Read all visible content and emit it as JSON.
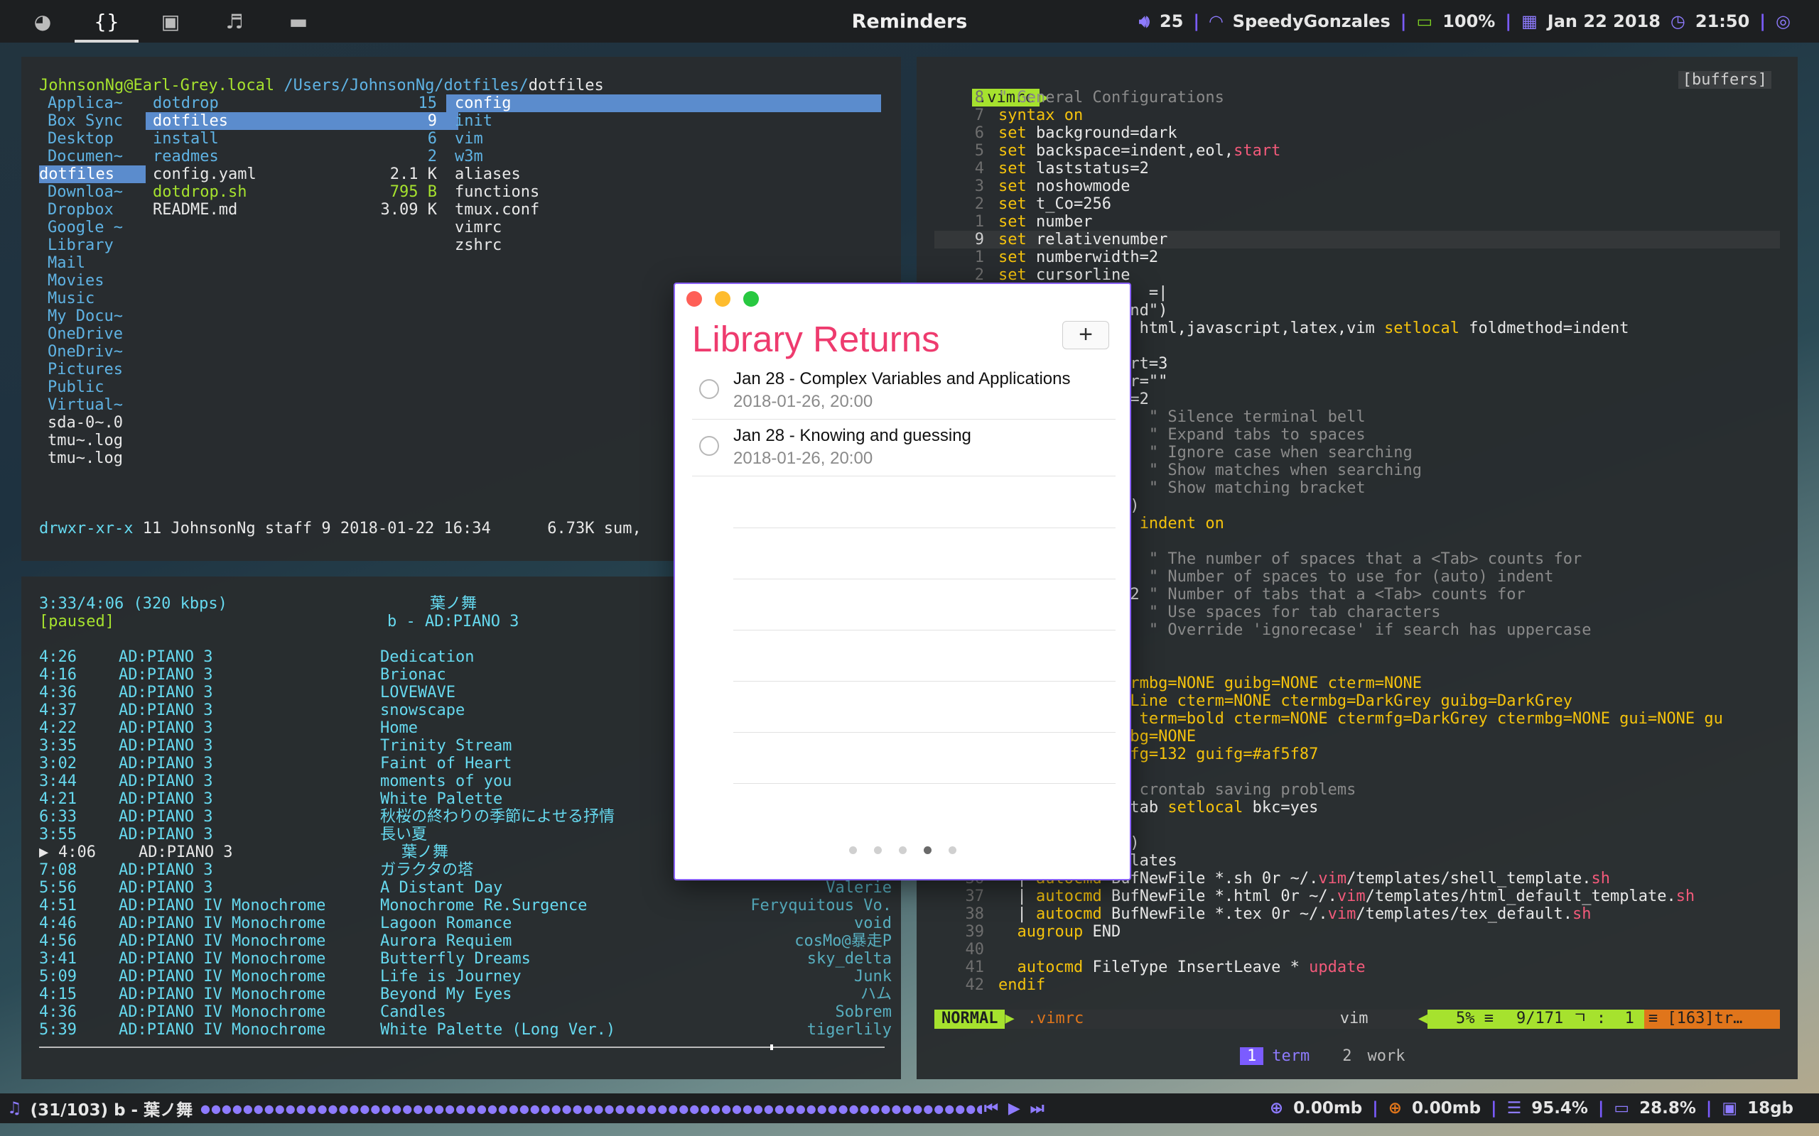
{
  "topbar": {
    "workspaces": [
      {
        "icon": "ghost-icon",
        "glyph": "◕",
        "active": false
      },
      {
        "icon": "code-braces-icon",
        "glyph": "{}",
        "active": true
      },
      {
        "icon": "terminal-icon",
        "glyph": "▣",
        "active": false
      },
      {
        "icon": "music-icon",
        "glyph": "♬",
        "active": false
      },
      {
        "icon": "folder-icon",
        "glyph": "▬",
        "active": false
      }
    ],
    "title": "Reminders",
    "volume": "25",
    "wifi": "SpeedyGonzales",
    "battery": "100%",
    "date": "Jan 22 2018",
    "time": "21:50"
  },
  "ranger": {
    "header_user": "JohnsonNg@Earl-Grey.local",
    "header_path": "/Users/JohnsonNg/dotfiles/",
    "header_dir": "dotfiles",
    "col1": [
      "Applica~",
      "Box Sync",
      "Desktop",
      "Documen~",
      "dotfiles",
      "Downloa~",
      "Dropbox",
      "Google ~",
      "Library",
      "Mail",
      "Movies",
      "Music",
      "My Docu~",
      "OneDrive",
      "OneDriv~",
      "Pictures",
      "Public",
      "Virtual~",
      "sda-0~.0",
      "tmu~.log",
      "tmu~.log"
    ],
    "col2": [
      {
        "name": "dotdrop",
        "size": "15"
      },
      {
        "name": "dotfiles",
        "size": "9"
      },
      {
        "name": "install",
        "size": "6"
      },
      {
        "name": "readmes",
        "size": "2"
      },
      {
        "name": "config.yaml",
        "size": "2.1 K"
      },
      {
        "name": "dotdrop.sh",
        "size": "795 B"
      },
      {
        "name": "README.md",
        "size": "3.09 K"
      }
    ],
    "col3": [
      "config",
      "init",
      "vim",
      "w3m",
      "aliases",
      "functions",
      "tmux.conf",
      "vimrc",
      "zshrc"
    ],
    "status_perm": "drwxr-xr-x",
    "status_rest": " 11 JohnsonNg staff 9 2018-01-22 16:34",
    "status_sum": "6.73K sum,"
  },
  "player": {
    "time": "3:33/4:06 (320 kbps)",
    "state": "[paused]",
    "title": "葉ノ舞",
    "album": "b - AD:PIANO 3",
    "tracks": [
      {
        "dur": "4:26",
        "album": "AD:PIANO 3",
        "title": "Dedication",
        "artist": ""
      },
      {
        "dur": "4:16",
        "album": "AD:PIANO 3",
        "title": "Brionac",
        "artist": ""
      },
      {
        "dur": "4:36",
        "album": "AD:PIANO 3",
        "title": "LOVEWAVE",
        "artist": ""
      },
      {
        "dur": "4:37",
        "album": "AD:PIANO 3",
        "title": "snowscape",
        "artist": ""
      },
      {
        "dur": "4:22",
        "album": "AD:PIANO 3",
        "title": "Home",
        "artist": ""
      },
      {
        "dur": "3:35",
        "album": "AD:PIANO 3",
        "title": "Trinity Stream",
        "artist": ""
      },
      {
        "dur": "3:02",
        "album": "AD:PIANO 3",
        "title": "Faint of Heart",
        "artist": ""
      },
      {
        "dur": "3:44",
        "album": "AD:PIANO 3",
        "title": "moments of you",
        "artist": ""
      },
      {
        "dur": "4:21",
        "album": "AD:PIANO 3",
        "title": "White Palette",
        "artist": ""
      },
      {
        "dur": "6:33",
        "album": "AD:PIANO 3",
        "title": "秋桜の終わりの季節によせる抒情",
        "artist": ""
      },
      {
        "dur": "3:55",
        "album": "AD:PIANO 3",
        "title": "長い夏",
        "artist": ""
      },
      {
        "dur": "4:06",
        "album": "AD:PIANO 3",
        "title": "葉ノ舞",
        "artist": "",
        "current": true
      },
      {
        "dur": "7:08",
        "album": "AD:PIANO 3",
        "title": "ガラクタの塔",
        "artist": ""
      },
      {
        "dur": "5:56",
        "album": "AD:PIANO 3",
        "title": "A Distant Day",
        "artist": "Valerie"
      },
      {
        "dur": "4:51",
        "album": "AD:PIANO IV Monochrome",
        "title": "Monochrome Re.Surgence",
        "artist": "Feryquitous Vo."
      },
      {
        "dur": "4:46",
        "album": "AD:PIANO IV Monochrome",
        "title": "Lagoon Romance",
        "artist": "void"
      },
      {
        "dur": "4:56",
        "album": "AD:PIANO IV Monochrome",
        "title": "Aurora Requiem",
        "artist": "cosMo@暴走P"
      },
      {
        "dur": "3:41",
        "album": "AD:PIANO IV Monochrome",
        "title": "Butterfly Dreams",
        "artist": "sky_delta"
      },
      {
        "dur": "5:09",
        "album": "AD:PIANO IV Monochrome",
        "title": "Life is Journey",
        "artist": "Junk"
      },
      {
        "dur": "4:15",
        "album": "AD:PIANO IV Monochrome",
        "title": "Beyond My Eyes",
        "artist": "ハム"
      },
      {
        "dur": "4:36",
        "album": "AD:PIANO IV Monochrome",
        "title": "Candles",
        "artist": "Sobrem"
      },
      {
        "dur": "5:39",
        "album": "AD:PIANO IV Monochrome",
        "title": "White Palette (Long Ver.)",
        "artist": "tigerlily"
      }
    ],
    "progress": 0.865
  },
  "vim": {
    "tab_file": ".vimrc",
    "tab_buffers": "[buffers]",
    "lines": [
      {
        "n": "8",
        "code": [
          [
            "gray",
            "\" General Configurations"
          ]
        ]
      },
      {
        "n": "7",
        "code": [
          [
            "ylw",
            "syntax on"
          ]
        ]
      },
      {
        "n": "6",
        "code": [
          [
            "ylw",
            "set "
          ],
          [
            "white",
            "background=dark"
          ]
        ]
      },
      {
        "n": "5",
        "code": [
          [
            "ylw",
            "set "
          ],
          [
            "white",
            "backspace=indent,eol,"
          ],
          [
            "red",
            "start"
          ]
        ]
      },
      {
        "n": "4",
        "code": [
          [
            "ylw",
            "set "
          ],
          [
            "white",
            "laststatus=2"
          ]
        ]
      },
      {
        "n": "3",
        "code": [
          [
            "ylw",
            "set "
          ],
          [
            "white",
            "noshowmode"
          ]
        ]
      },
      {
        "n": "2",
        "code": [
          [
            "ylw",
            "set "
          ],
          [
            "white",
            "t_Co=256"
          ]
        ]
      },
      {
        "n": "1",
        "code": [
          [
            "ylw",
            "set "
          ],
          [
            "white",
            "number"
          ]
        ]
      },
      {
        "n": "9",
        "cur": true,
        "code": [
          [
            "ylw",
            "set "
          ],
          [
            "white",
            "relativenumber"
          ]
        ]
      },
      {
        "n": "1",
        "code": [
          [
            "ylw",
            "set "
          ],
          [
            "white",
            "numberwidth=2"
          ]
        ]
      },
      {
        "n": "2",
        "code": [
          [
            "ylw",
            "set "
          ],
          [
            "white",
            "cursorline"
          ]
        ]
      },
      {
        "n": "",
        "code": [
          [
            "white",
            "                =|"
          ]
        ]
      },
      {
        "n": "",
        "code": [
          [
            "white",
            "              nd\")"
          ]
        ]
      },
      {
        "n": "",
        "code": [
          [
            "white",
            "           tax html,javascript,latex,vim "
          ],
          [
            "ylw",
            "setlocal "
          ],
          [
            "white",
            "foldmethod=indent"
          ]
        ]
      },
      {
        "n": "",
        "code": [
          [
            "white",
            ""
          ]
        ]
      },
      {
        "n": "",
        "code": [
          [
            "white",
            "           start=3"
          ]
        ]
      },
      {
        "n": "",
        "code": [
          [
            "white",
            "           rsor=\"\""
          ]
        ]
      },
      {
        "n": "",
        "code": [
          [
            "white",
            "           vel=2"
          ]
        ]
      },
      {
        "n": "",
        "code": [
          [
            "white",
            "           l    "
          ],
          [
            "gray",
            "\" Silence terminal bell"
          ]
        ]
      },
      {
        "n": "",
        "code": [
          [
            "white",
            "                "
          ],
          [
            "gray",
            "\" Expand tabs to spaces"
          ]
        ]
      },
      {
        "n": "",
        "code": [
          [
            "white",
            "           e    "
          ],
          [
            "gray",
            "\" Ignore case when searching"
          ]
        ]
      },
      {
        "n": "",
        "code": [
          [
            "white",
            "                "
          ],
          [
            "gray",
            "\" Show matches when searching"
          ]
        ]
      },
      {
        "n": "",
        "code": [
          [
            "white",
            "                "
          ],
          [
            "gray",
            "\" Show matching bracket"
          ]
        ]
      },
      {
        "n": "",
        "code": [
          [
            "white",
            "           nd\")"
          ]
        ]
      },
      {
        "n": "",
        "code": [
          [
            "white",
            "           gin "
          ],
          [
            "ylw",
            "indent on"
          ]
        ]
      },
      {
        "n": "",
        "code": [
          [
            "white",
            ""
          ]
        ]
      },
      {
        "n": "",
        "code": [
          [
            "white",
            "                "
          ],
          [
            "gray",
            "\" The number of spaces that a <Tab> counts for"
          ]
        ]
      },
      {
        "n": "",
        "code": [
          [
            "white",
            "           n=2  "
          ],
          [
            "gray",
            "\" Number of spaces to use for (auto) indent"
          ]
        ]
      },
      {
        "n": "",
        "code": [
          [
            "white",
            "           op=2 "
          ],
          [
            "gray",
            "\" Number of tabs that a <Tab> counts for"
          ]
        ]
      },
      {
        "n": "",
        "code": [
          [
            "white",
            "                "
          ],
          [
            "gray",
            "\" Use spaces for tab characters"
          ]
        ]
      },
      {
        "n": "",
        "code": [
          [
            "white",
            "                "
          ],
          [
            "gray",
            "\" Override 'ignorecase' if search has uppercase"
          ]
        ]
      },
      {
        "n": "",
        "code": [
          [
            "white",
            ""
          ]
        ]
      },
      {
        "n": "",
        "code": [
          [
            "white",
            ""
          ]
        ]
      },
      {
        "n": "",
        "code": [
          [
            "ylw",
            "           ctermbg=NONE guibg=NONE cterm=NONE"
          ]
        ]
      },
      {
        "n": "",
        "code": [
          [
            "ylw",
            "           sorLine cterm=NONE ctermbg=DarkGrey guibg=DarkGrey"
          ]
        ]
      },
      {
        "n": "",
        "code": [
          [
            "ylw",
            "           eNr term=bold cterm=NONE ctermfg=DarkGrey ctermbg=NONE gui=NONE gu"
          ]
        ]
      },
      {
        "n": "",
        "code": [
          [
            "ylw",
            "           guibg=NONE"
          ]
        ]
      },
      {
        "n": "",
        "code": [
          [
            "ylw",
            "           ermfg=132 guifg=#af5f87"
          ]
        ]
      },
      {
        "n": "",
        "code": [
          [
            "white",
            ""
          ]
        ]
      },
      {
        "n": "",
        "code": [
          [
            "gray",
            "           for crontab saving problems"
          ]
        ]
      },
      {
        "n": "",
        "code": [
          [
            "white",
            "           rontab "
          ],
          [
            "ylw",
            "setlocal "
          ],
          [
            "white",
            "bkc=yes"
          ]
        ]
      },
      {
        "n": "",
        "code": [
          [
            "white",
            ""
          ]
        ]
      },
      {
        "n": "",
        "code": [
          [
            "white",
            "           nd\")"
          ]
        ]
      },
      {
        "n": "",
        "code": [
          [
            "ylw",
            "  augroup "
          ],
          [
            "white",
            "templates"
          ]
        ]
      },
      {
        "n": "36",
        "code": [
          [
            "white",
            "  | "
          ],
          [
            "ylw",
            "autocmd "
          ],
          [
            "white",
            "BufNewFile *.sh 0r ~/."
          ],
          [
            "red",
            "vim"
          ],
          [
            "white",
            "/templates/shell_template."
          ],
          [
            "red",
            "sh"
          ]
        ]
      },
      {
        "n": "37",
        "code": [
          [
            "white",
            "  | "
          ],
          [
            "ylw",
            "autocmd "
          ],
          [
            "white",
            "BufNewFile *.html 0r ~/."
          ],
          [
            "red",
            "vim"
          ],
          [
            "white",
            "/templates/html_default_template."
          ],
          [
            "red",
            "sh"
          ]
        ]
      },
      {
        "n": "38",
        "code": [
          [
            "white",
            "  | "
          ],
          [
            "ylw",
            "autocmd "
          ],
          [
            "white",
            "BufNewFile *.tex 0r ~/."
          ],
          [
            "red",
            "vim"
          ],
          [
            "white",
            "/templates/tex_default."
          ],
          [
            "red",
            "sh"
          ]
        ]
      },
      {
        "n": "39",
        "code": [
          [
            "ylw",
            "  augroup "
          ],
          [
            "white",
            "END"
          ]
        ]
      },
      {
        "n": "40",
        "code": [
          [
            "white",
            ""
          ]
        ]
      },
      {
        "n": "41",
        "code": [
          [
            "ylw",
            "  autocmd "
          ],
          [
            "white",
            "FileType InsertLeave * "
          ],
          [
            "red",
            "update"
          ]
        ]
      },
      {
        "n": "42",
        "code": [
          [
            "ylw",
            "endif"
          ]
        ]
      }
    ],
    "status_mode": "NORMAL",
    "status_file": ".vimrc",
    "status_ft": "vim",
    "status_pct": "5% ≡",
    "status_pos": "9/171 ㄱ :  1",
    "status_warn": "≡ [163]tr…",
    "tmux_tabs": [
      {
        "num": "1",
        "name": "term",
        "active": true
      },
      {
        "num": "2",
        "name": "work",
        "active": false
      }
    ]
  },
  "reminders": {
    "list_title": "Library Returns",
    "add_label": "+",
    "items": [
      {
        "title": "Jan 28 - Complex Variables and Applications",
        "due": "2018-01-26, 20:00"
      },
      {
        "title": "Jan 28 - Knowing and guessing",
        "due": "2018-01-26, 20:00"
      }
    ],
    "page_count": 5,
    "current_page": 4
  },
  "bottombar": {
    "now_playing": "(31/103) b - 葉ノ舞",
    "download": "0.00mb",
    "upload": "0.00mb",
    "cpu": "95.4%",
    "memory": "28.8%",
    "disk": "18gb"
  },
  "colors": {
    "accent": "#8e7bff",
    "reminder_title": "#ee3b6e",
    "vim_green": "#a6e22e",
    "vim_orange": "#e0751b"
  }
}
